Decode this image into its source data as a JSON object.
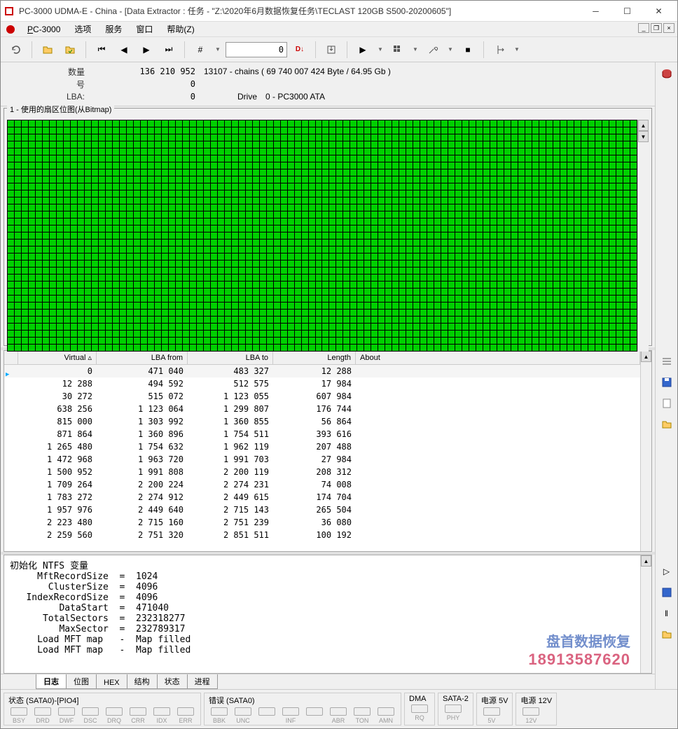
{
  "window": {
    "title": "PC-3000 UDMA-E - China - [Data Extractor : 任务 - \"Z:\\2020年6月数据恢复任务\\TECLAST 120GB S500-20200605\"]"
  },
  "menubar": {
    "app": "PC-3000",
    "items": [
      "选项",
      "服务",
      "窗口",
      "帮助(Z)"
    ]
  },
  "toolbar": {
    "combo_value": "0",
    "combo_marker": "D↓"
  },
  "info": {
    "qty_label": "数量",
    "qty_value": "136 210 952",
    "qty_extra": "13107 - chains  ( 69 740 007 424 Byte /  64.95 Gb )",
    "num_label": "号",
    "num_value": "0",
    "lba_label": "LBA:",
    "lba_value": "0",
    "drive_label": "Drive",
    "drive_value": "0 - PC3000 ATA"
  },
  "bitmap": {
    "title": "1 - 使用的扇区位图(从Bitmap)"
  },
  "table": {
    "headers": {
      "virtual": "Virtual ▵",
      "lba_from": "LBA from",
      "lba_to": "LBA to",
      "length": "Length",
      "about": "About"
    },
    "rows": [
      {
        "virtual": "0",
        "from": "471 040",
        "to": "483 327",
        "len": "12 288"
      },
      {
        "virtual": "12 288",
        "from": "494 592",
        "to": "512 575",
        "len": "17 984"
      },
      {
        "virtual": "30 272",
        "from": "515 072",
        "to": "1 123 055",
        "len": "607 984"
      },
      {
        "virtual": "638 256",
        "from": "1 123 064",
        "to": "1 299 807",
        "len": "176 744"
      },
      {
        "virtual": "815 000",
        "from": "1 303 992",
        "to": "1 360 855",
        "len": "56 864"
      },
      {
        "virtual": "871 864",
        "from": "1 360 896",
        "to": "1 754 511",
        "len": "393 616"
      },
      {
        "virtual": "1 265 480",
        "from": "1 754 632",
        "to": "1 962 119",
        "len": "207 488"
      },
      {
        "virtual": "1 472 968",
        "from": "1 963 720",
        "to": "1 991 703",
        "len": "27 984"
      },
      {
        "virtual": "1 500 952",
        "from": "1 991 808",
        "to": "2 200 119",
        "len": "208 312"
      },
      {
        "virtual": "1 709 264",
        "from": "2 200 224",
        "to": "2 274 231",
        "len": "74 008"
      },
      {
        "virtual": "1 783 272",
        "from": "2 274 912",
        "to": "2 449 615",
        "len": "174 704"
      },
      {
        "virtual": "1 957 976",
        "from": "2 449 640",
        "to": "2 715 143",
        "len": "265 504"
      },
      {
        "virtual": "2 223 480",
        "from": "2 715 160",
        "to": "2 751 239",
        "len": "36 080"
      },
      {
        "virtual": "2 259 560",
        "from": "2 751 320",
        "to": "2 851 511",
        "len": "100 192"
      }
    ]
  },
  "log": {
    "lines": [
      "初始化 NTFS 变量",
      "     MftRecordSize  =  1024",
      "       ClusterSize  =  4096",
      "   IndexRecordSize  =  4096",
      "         DataStart  =  471040",
      "      TotalSectors  =  232318277",
      "         MaxSector  =  232789317",
      "     Load MFT map   -  Map filled",
      "     Load MFT map   -  Map filled"
    ]
  },
  "watermark": {
    "text": "盘首数据恢复",
    "phone": "18913587620"
  },
  "tabs": {
    "items": [
      "日志",
      "位图",
      "HEX",
      "结构",
      "状态",
      "进程"
    ],
    "active": 0
  },
  "status": {
    "groups": [
      {
        "title": "状态 (SATA0)-[PIO4]",
        "leds": [
          "BSY",
          "DRD",
          "DWF",
          "DSC",
          "DRQ",
          "CRR",
          "IDX",
          "ERR"
        ]
      },
      {
        "title": "错误 (SATA0)",
        "leds": [
          "BBK",
          "UNC",
          "",
          "INF",
          "",
          "ABR",
          "TON",
          "AMN"
        ]
      },
      {
        "title": "DMA",
        "leds": [
          "RQ"
        ]
      },
      {
        "title": "SATA-2",
        "leds": [
          "PHY"
        ]
      },
      {
        "title": "电源 5V",
        "leds": [
          "5V"
        ]
      },
      {
        "title": "电源 12V",
        "leds": [
          "12V"
        ]
      }
    ]
  }
}
